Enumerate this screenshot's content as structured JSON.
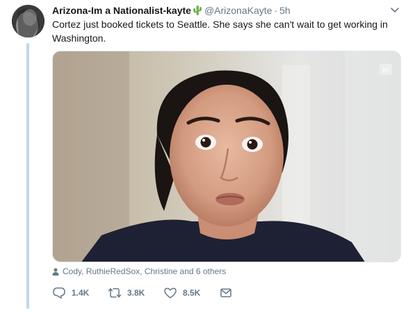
{
  "tweet": {
    "display_name": "Arizona-Im a Nationalist-kayte",
    "name_emoji_icon": "cactus-icon",
    "handle": "@ArizonaKayte",
    "separator": "·",
    "time": "5h",
    "text": "Cortez just booked tickets to Seattle. She says she can't wait to get working in Washington.",
    "media_watermark": "In",
    "likers": "Cody, RuthieRedSox, Christine and 6 others",
    "actions": {
      "reply_count": "1.4K",
      "retweet_count": "3.8K",
      "like_count": "8.5K"
    }
  },
  "colors": {
    "secondary_text": "#657786",
    "thread_line": "#bdd9e8",
    "primary_text": "#14171a"
  }
}
